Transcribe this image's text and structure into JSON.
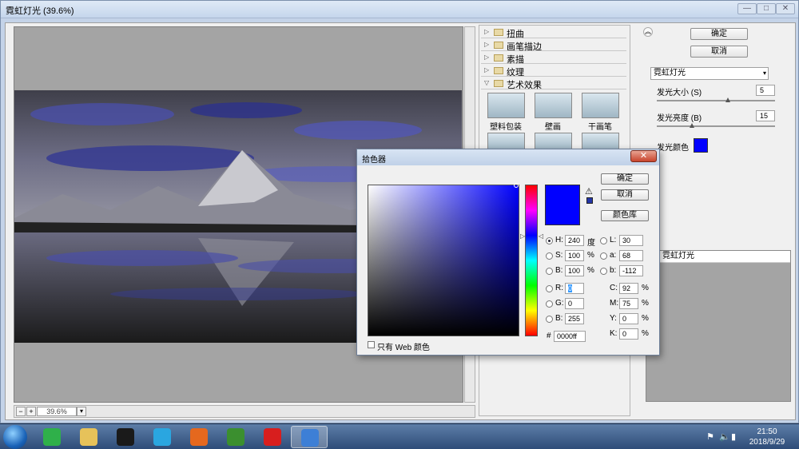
{
  "window": {
    "title": "霓虹灯光 (39.6%)",
    "min": "—",
    "max": "□",
    "close": "✕"
  },
  "preview": {
    "zoom": "39.6%",
    "zoom_minus": "−",
    "zoom_plus": "+"
  },
  "gallery": {
    "categories": [
      {
        "label": "扭曲",
        "expanded": false
      },
      {
        "label": "画笔描边",
        "expanded": false
      },
      {
        "label": "素描",
        "expanded": false
      },
      {
        "label": "纹理",
        "expanded": false
      },
      {
        "label": "艺术效果",
        "expanded": true
      }
    ],
    "thumbs": [
      {
        "label": "塑料包装"
      },
      {
        "label": "壁画"
      },
      {
        "label": "干画笔"
      }
    ]
  },
  "panel": {
    "ok": "确定",
    "cancel": "取消",
    "filter_select": "霓虹灯光",
    "glow_size_label": "发光大小 (S)",
    "glow_size_value": "5",
    "glow_size_pos": 0.6,
    "glow_brightness_label": "发光亮度 (B)",
    "glow_brightness_value": "15",
    "glow_brightness_pos": 0.3,
    "glow_color_label": "发光颜色",
    "glow_color": "#0000ff",
    "layer_name": "霓虹灯光"
  },
  "picker": {
    "title": "拾色器",
    "close": "✕",
    "ok": "确定",
    "cancel": "取消",
    "library": "颜色库",
    "warn_icon": "⚠",
    "fields": {
      "H": {
        "label": "H:",
        "value": "240",
        "unit": "度"
      },
      "S": {
        "label": "S:",
        "value": "100",
        "unit": "%"
      },
      "Bv": {
        "label": "B:",
        "value": "100",
        "unit": "%"
      },
      "R": {
        "label": "R:",
        "value": "0"
      },
      "G": {
        "label": "G:",
        "value": "0"
      },
      "Bl": {
        "label": "B:",
        "value": "255"
      },
      "L": {
        "label": "L:",
        "value": "30"
      },
      "a": {
        "label": "a:",
        "value": "68"
      },
      "b": {
        "label": "b:",
        "value": "-112"
      },
      "C": {
        "label": "C:",
        "value": "92",
        "unit": "%"
      },
      "M": {
        "label": "M:",
        "value": "75",
        "unit": "%"
      },
      "Y": {
        "label": "Y:",
        "value": "0",
        "unit": "%"
      },
      "K": {
        "label": "K:",
        "value": "0",
        "unit": "%"
      }
    },
    "hex_label": "#",
    "hex_value": "0000ff",
    "web_only_label": "只有 Web 颜色",
    "current_color": "#0000ff"
  },
  "taskbar": {
    "time": "21:50",
    "date": "2018/9/29",
    "apps": [
      {
        "name": "360-browser-icon",
        "color": "#2fb04a"
      },
      {
        "name": "file-explorer-icon",
        "color": "#e6c25a"
      },
      {
        "name": "qq-icon",
        "color": "#1a1a1a"
      },
      {
        "name": "video-player-icon",
        "color": "#2aa6e0"
      },
      {
        "name": "firefox-icon",
        "color": "#e5681e"
      },
      {
        "name": "media-app-icon",
        "color": "#3b8f2f"
      },
      {
        "name": "record-icon",
        "color": "#d81e1e"
      },
      {
        "name": "photoshop-icon",
        "color": "#3d7fd6"
      }
    ]
  }
}
